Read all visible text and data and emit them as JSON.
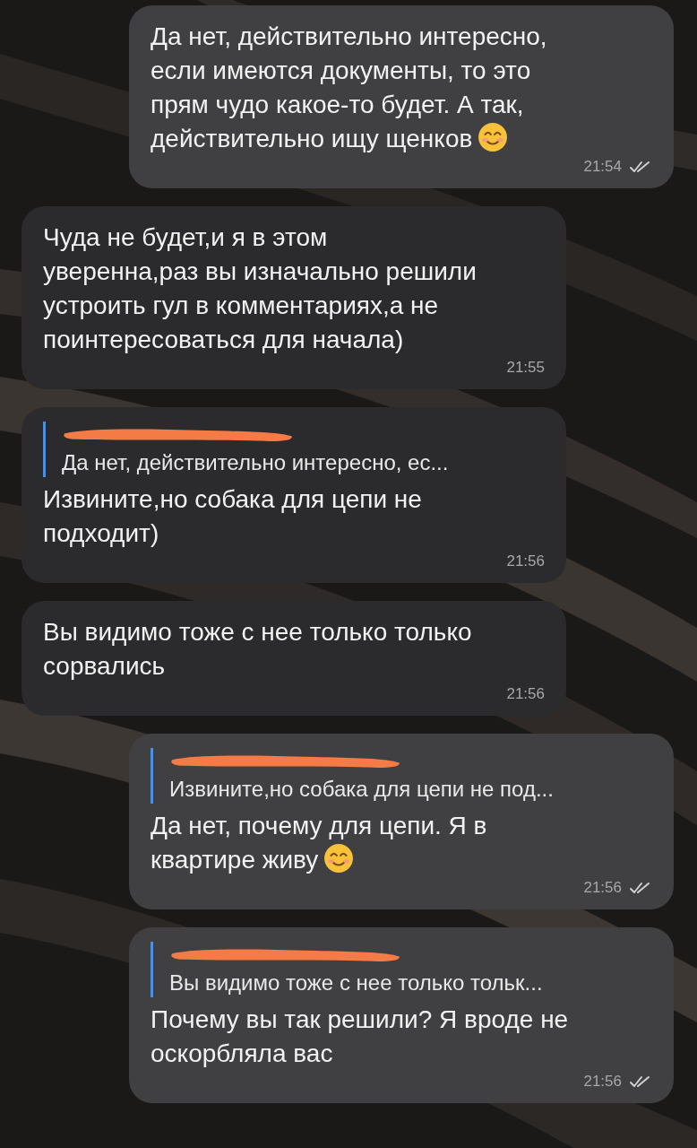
{
  "messages": [
    {
      "kind": "outgoing",
      "text": "Да нет, действительно интересно, если имеются документы, то это прям чудо какое-то будет. А так, действительно ищу щенков",
      "emoji": true,
      "time": "21:54",
      "read": true
    },
    {
      "kind": "incoming",
      "text": "Чуда не будет,и я в этом уверенна,раз вы изначально решили устроить гул в комментариях,а не поинтересоваться для начала)",
      "emoji": false,
      "time": "21:55"
    },
    {
      "kind": "incoming",
      "quote": {
        "text": "Да нет, действительно интересно, ес...",
        "redacted": true
      },
      "text": "Извините,но собака для цепи не подходит)",
      "emoji": false,
      "time": "21:56"
    },
    {
      "kind": "incoming",
      "text": "Вы видимо тоже с нее только только сорвались",
      "emoji": false,
      "time": "21:56"
    },
    {
      "kind": "outgoing",
      "quote": {
        "text": "Извините,но собака для цепи не под...",
        "redacted": true
      },
      "text": "Да нет, почему для цепи. Я в квартире живу",
      "emoji": true,
      "time": "21:56",
      "read": true
    },
    {
      "kind": "outgoing",
      "quote": {
        "text": "Вы видимо тоже с нее только тольк...",
        "redacted": true
      },
      "text": "Почему вы так решили? Я вроде не оскорбляла вас",
      "emoji": false,
      "time": "21:56",
      "read": true
    }
  ]
}
